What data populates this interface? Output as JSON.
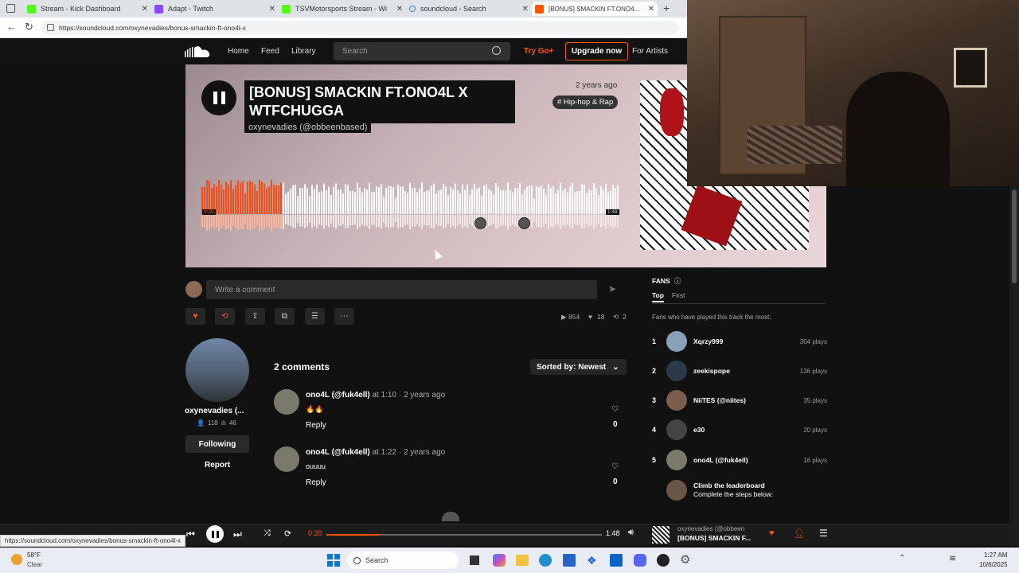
{
  "browser": {
    "tabs": [
      {
        "label": "Stream - Kick Dashboard",
        "color": "#53fc18"
      },
      {
        "label": "Adapt - Twitch",
        "color": "#9146ff"
      },
      {
        "label": "TSVMotorsports Stream - Wi",
        "color": "#53fc18"
      },
      {
        "label": "soundcloud - Search",
        "color": "#4285f4"
      },
      {
        "label": "[BONUS] SMACKIN FT.ONO4...",
        "color": "#ff5500"
      }
    ],
    "url": "https://soundcloud.com/oxynevadies/bonus-smackin-ft-ono4l-x",
    "status_url": "https://soundcloud.com/oxynevadies/bonus-smackin-ft-ono4l-x"
  },
  "header": {
    "nav": [
      "Home",
      "Feed",
      "Library"
    ],
    "search_placeholder": "Search",
    "try_go": "Try Go+",
    "upgrade": "Upgrade now",
    "for_artists": "For Artists"
  },
  "track": {
    "title_line1": "[BONUS] SMACKIN FT.ONO4L X",
    "title_line2": "WTFCHUGGA",
    "artist": "oxynevadies (@obbeenbased)",
    "posted": "2 years ago",
    "tag": "# Hip-hop & Rap",
    "elapsed": "0:20",
    "duration": "1:48",
    "progress": 0.19
  },
  "comment_input": {
    "placeholder": "Write a comment"
  },
  "stats": {
    "plays": "854",
    "likes": "18",
    "reposts": "2"
  },
  "uploader": {
    "name": "oxynevadies (...",
    "followers": "118",
    "tracks": "46",
    "following_label": "Following",
    "report_label": "Report"
  },
  "comments": {
    "count_label": "2 comments",
    "sort_label": "Sorted by: Newest",
    "items": [
      {
        "user": "ono4L (@fuk4ell)",
        "at": "at",
        "time": "1:10",
        "ago": "· 2 years ago",
        "text": "🔥🔥",
        "reply": "Reply",
        "likes": "0"
      },
      {
        "user": "ono4L (@fuk4ell)",
        "at": "at",
        "time": "1:22",
        "ago": "· 2 years ago",
        "text": "ouuuu",
        "reply": "Reply",
        "likes": "0"
      }
    ]
  },
  "fans": {
    "title": "FANS",
    "tabs": [
      "Top",
      "First"
    ],
    "subtitle": "Fans who have played this track the most:",
    "items": [
      {
        "rank": "1",
        "name": "Xqrzy999",
        "plays": "304 plays"
      },
      {
        "rank": "2",
        "name": "zeekispope",
        "plays": "136 plays"
      },
      {
        "rank": "3",
        "name": "NiiTES (@niites)",
        "plays": "35 plays"
      },
      {
        "rank": "4",
        "name": "e30",
        "plays": "20 plays"
      },
      {
        "rank": "5",
        "name": "ono4L (@fuk4ell)",
        "plays": "16 plays"
      }
    ],
    "climb_title": "Climb the leaderboard",
    "climb_sub": "Complete the steps below:"
  },
  "player": {
    "elapsed": "0:20",
    "duration": "1:48",
    "progress": 0.19,
    "artist": "oxynevadies (@obbeen",
    "title": "[BONUS] SMACKIN F..."
  },
  "taskbar": {
    "temp": "58°F",
    "weather": "Clear",
    "search": "Search",
    "time": "1:27 AM",
    "date": "10/6/2025"
  }
}
